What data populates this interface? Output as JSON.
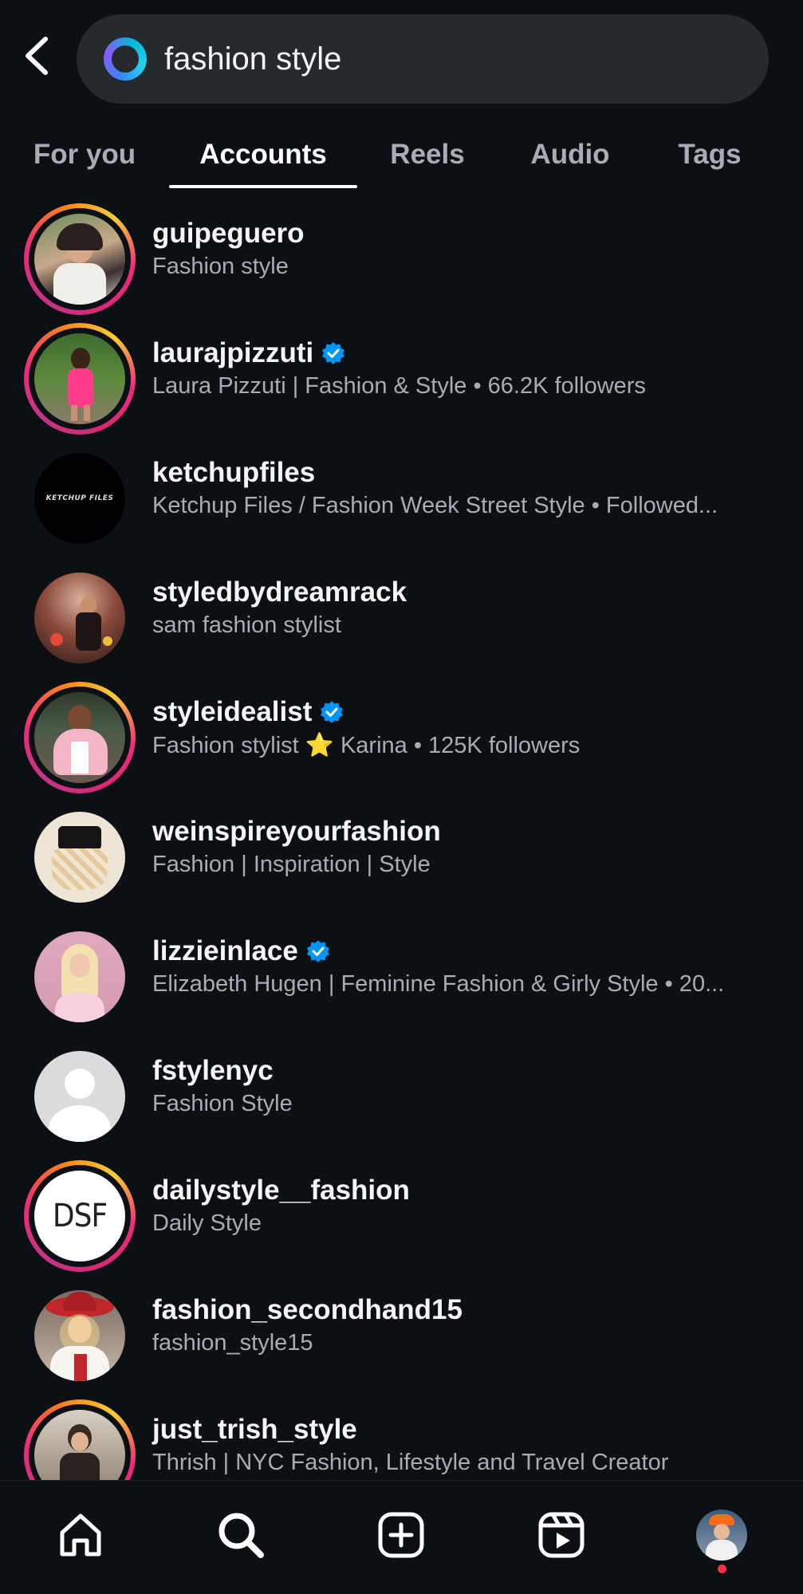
{
  "search": {
    "query": "fashion style"
  },
  "tabs": [
    {
      "label": "For you"
    },
    {
      "label": "Accounts"
    },
    {
      "label": "Reels"
    },
    {
      "label": "Audio"
    },
    {
      "label": "Tags"
    }
  ],
  "active_tab": "Accounts",
  "accounts": [
    {
      "username": "guipeguero",
      "subtitle": "Fashion style",
      "verified": false,
      "story_ring": true,
      "avatar_color": "#c9a98a"
    },
    {
      "username": "laurajpizzuti",
      "subtitle": "Laura Pizzuti | Fashion & Style • 66.2K followers",
      "verified": true,
      "story_ring": true,
      "avatar_color": "#4e7a3c"
    },
    {
      "username": "ketchupfiles",
      "subtitle": "Ketchup Files / Fashion Week Street Style • Followed...",
      "verified": false,
      "story_ring": false,
      "avatar_color": "#000000",
      "avatar_text": "KETCHUP FILES"
    },
    {
      "username": "styledbydreamrack",
      "subtitle": "sam fashion stylist",
      "verified": false,
      "story_ring": false,
      "avatar_color": "#7a4a3a"
    },
    {
      "username": "styleidealist",
      "subtitle": "Fashion stylist ⭐ Karina • 125K followers",
      "verified": true,
      "story_ring": true,
      "avatar_color": "#e8b4c0"
    },
    {
      "username": "weinspireyourfashion",
      "subtitle": "Fashion | Inspiration | Style",
      "verified": false,
      "story_ring": false,
      "avatar_color": "#e9dccb"
    },
    {
      "username": "lizzieinlace",
      "subtitle": "Elizabeth Hugen | Feminine Fashion & Girly Style • 20...",
      "verified": true,
      "story_ring": false,
      "avatar_color": "#d9a3b8"
    },
    {
      "username": "fstylenyc",
      "subtitle": "Fashion Style",
      "verified": false,
      "story_ring": false,
      "avatar_color": "#dbdbdb",
      "default_avatar": true
    },
    {
      "username": "dailystyle__fashion",
      "subtitle": "Daily Style",
      "verified": false,
      "story_ring": true,
      "avatar_color": "#ffffff",
      "avatar_text": "DSF"
    },
    {
      "username": "fashion_secondhand15",
      "subtitle": "fashion_style15",
      "verified": false,
      "story_ring": false,
      "avatar_color": "#b3262a"
    },
    {
      "username": "just_trish_style",
      "subtitle": "Thrish | NYC Fashion, Lifestyle and Travel Creator",
      "verified": false,
      "story_ring": true,
      "avatar_color": "#8c7a6a"
    }
  ],
  "bottom_nav": [
    {
      "icon": "home-icon"
    },
    {
      "icon": "search-icon"
    },
    {
      "icon": "create-icon"
    },
    {
      "icon": "reels-icon"
    },
    {
      "icon": "profile-avatar"
    }
  ],
  "colors": {
    "background": "#0c1014",
    "search_bg": "#262a2f",
    "text_primary": "#f5f5f5",
    "text_secondary": "#a8adb3",
    "verified_blue": "#0095f6",
    "notification_red": "#ff3040"
  }
}
